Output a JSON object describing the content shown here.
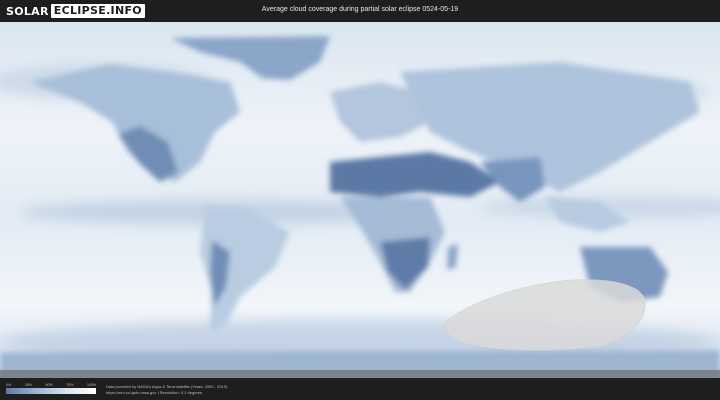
{
  "header": {
    "logo_part1": "SOLAR",
    "logo_part2": "ECLIPSE.INFO",
    "title": "Average cloud coverage during partial solar eclipse 0524-05-19"
  },
  "map": {
    "type": "world cloud coverage",
    "colors": {
      "clear": "#5f7ba6",
      "cloudy": "#ffffff",
      "eclipse_zone": "#d9d9d9"
    }
  },
  "legend": {
    "ticks": [
      "0%",
      "25%",
      "50%",
      "75%",
      "100%"
    ]
  },
  "footer": {
    "credit_line1": "Data provided by NASA's Aqua & Terra satellite (Years: 2000 - 2019)",
    "credit_line2": "https://neo.sci.gsfc.nasa.gov | Resolution: 0.1 degrees"
  }
}
